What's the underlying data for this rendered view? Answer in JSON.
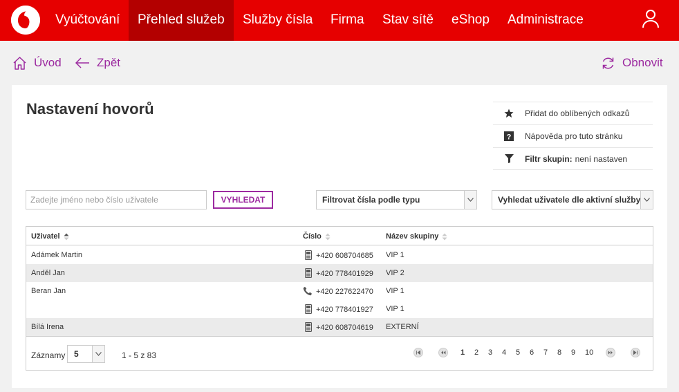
{
  "nav": {
    "items": [
      "Vyúčtování",
      "Přehled služeb",
      "Služby čísla",
      "Firma",
      "Stav sítě",
      "eShop",
      "Administrace"
    ],
    "active_index": 1,
    "brand_color": "#e60000",
    "active_color": "#b30000"
  },
  "actions": {
    "home_label": "Úvod",
    "back_label": "Zpět",
    "refresh_label": "Obnovit",
    "accent_color": "#9c2aa0"
  },
  "page": {
    "title": "Nastavení hovorů",
    "side_links": {
      "favorite": "Přidat do oblíbených odkazů",
      "help": "Nápověda pro tuto stránku",
      "filter_label": "Filtr skupin:",
      "filter_value": "není nastaven"
    }
  },
  "search": {
    "placeholder": "Zadejte jméno nebo číslo uživatele",
    "button": "VYHLEDAT",
    "type_filter": "Filtrovat čísla podle typu",
    "service_filter": "Vyhledat uživatele dle aktivní služby"
  },
  "table": {
    "headers": {
      "user": "Uživatel",
      "number": "Číslo",
      "group": "Název skupiny"
    },
    "rows": [
      {
        "user": "Adámek Martin",
        "icon": "mobile-icon",
        "number": "+420 608704685",
        "group": "VIP 1"
      },
      {
        "user": "Anděl Jan",
        "icon": "mobile-icon",
        "number": "+420 778401929",
        "group": "VIP 2"
      },
      {
        "user": "Beran Jan",
        "icon": "phone-icon",
        "number": "+420 227622470",
        "group": "VIP 1"
      },
      {
        "user": "",
        "icon": "mobile-icon",
        "number": "+420 778401927",
        "group": "VIP 1"
      },
      {
        "user": "Bílá Irena",
        "icon": "mobile-icon",
        "number": "+420 608704619",
        "group": "EXTERNÍ"
      }
    ]
  },
  "pagination": {
    "records_label": "Záznamy",
    "page_size": "5",
    "range": "1 - 5 z 83",
    "pages": [
      "1",
      "2",
      "3",
      "4",
      "5",
      "6",
      "7",
      "8",
      "9",
      "10"
    ],
    "current_page": "1"
  }
}
